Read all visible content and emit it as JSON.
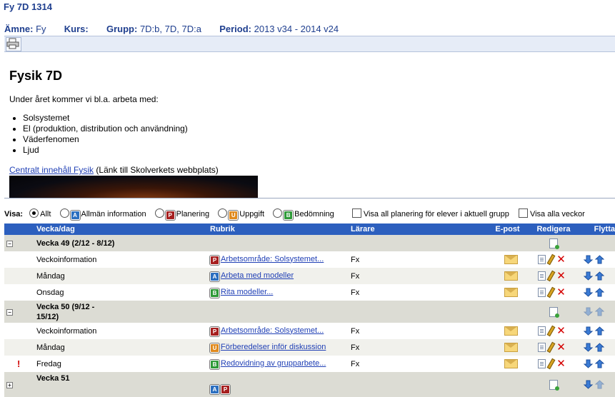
{
  "page": {
    "title": "Fy 7D 1314"
  },
  "meta": {
    "subject_label": "Ämne:",
    "subject_value": "Fy",
    "course_label": "Kurs:",
    "group_label": "Grupp:",
    "group_value": "7D:b, 7D, 7D:a",
    "period_label": "Period:",
    "period_value": "2013 v34 - 2014 v24"
  },
  "content": {
    "heading": "Fysik 7D",
    "intro": "Under året kommer vi bl.a. arbeta med:",
    "topics": [
      "Solsystemet",
      "El (produktion, distribution och användning)",
      "Väderfenomen",
      "Ljud"
    ],
    "link_text": "Centralt innehåll Fysik",
    "link_suffix": " (Länk till Skolverkets webbplats)"
  },
  "filter": {
    "label": "Visa:",
    "options": [
      {
        "label": "Allt",
        "selected": true
      },
      {
        "label": "Allmän information",
        "badge": "A"
      },
      {
        "label": "Planering",
        "badge": "P"
      },
      {
        "label": "Uppgift",
        "badge": "U"
      },
      {
        "label": "Bedömning",
        "badge": "B"
      }
    ],
    "check_all_planning": "Visa all planering för elever i aktuell grupp",
    "check_all_weeks": "Visa alla veckor"
  },
  "colors": {
    "header_blue": "#2c5fbe",
    "title_blue": "#1f3f8f",
    "badge_A": "#2b6fc0",
    "badge_P": "#a61f1f",
    "badge_U": "#e08a1e",
    "badge_B": "#2e9a38"
  },
  "table": {
    "headers": {
      "day": "Vecka/dag",
      "rubrik": "Rubrik",
      "teacher": "Lärare",
      "email": "E-post",
      "edit": "Redigera",
      "move": "Flytta"
    },
    "week49": {
      "title": "Vecka 49 (2/12 - 8/12)",
      "rows": [
        {
          "day": "Veckoinformation",
          "badge": "P",
          "rubrik": "Arbetsområde: Solsystemet...",
          "teacher": "Fx"
        },
        {
          "day": "Måndag",
          "badge": "A",
          "rubrik": "Arbeta med modeller",
          "teacher": "Fx"
        },
        {
          "day": "Onsdag",
          "badge": "B",
          "rubrik": "Rita modeller...",
          "teacher": "Fx"
        }
      ]
    },
    "week50": {
      "title": "Vecka 50 (9/12 - 15/12)",
      "rows": [
        {
          "day": "Veckoinformation",
          "badge": "P",
          "rubrik": "Arbetsområde: Solsystemet...",
          "teacher": "Fx"
        },
        {
          "day": "Måndag",
          "badge": "U",
          "rubrik": "Förberedelser inför diskussion",
          "teacher": "Fx"
        },
        {
          "day": "Fredag",
          "badge": "B",
          "rubrik": "Redovidning av grupparbete...",
          "teacher": "Fx",
          "flag": "!"
        }
      ]
    },
    "week51": {
      "title": "Vecka 51",
      "badges": [
        "A",
        "P"
      ]
    }
  }
}
